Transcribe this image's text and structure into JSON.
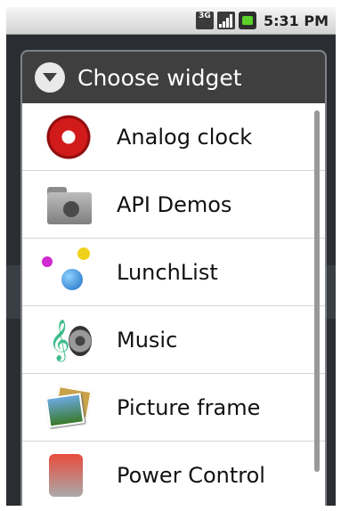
{
  "status_bar": {
    "network_label": "3G",
    "time": "5:31 PM",
    "icons": [
      "3g-icon",
      "signal-icon",
      "battery-icon"
    ]
  },
  "dialog": {
    "title": "Choose widget",
    "title_icon": "chevron-down-circle-icon",
    "items": [
      {
        "label": "Analog clock",
        "icon": "analog-clock-icon"
      },
      {
        "label": "API Demos",
        "icon": "folder-gear-icon"
      },
      {
        "label": "LunchList",
        "icon": "molecule-icon"
      },
      {
        "label": "Music",
        "icon": "music-icon"
      },
      {
        "label": "Picture frame",
        "icon": "picture-frame-icon"
      },
      {
        "label": "Power Control",
        "icon": "power-control-icon"
      }
    ]
  },
  "colors": {
    "title_bar": "#3f3f3f",
    "list_background": "#ffffff",
    "divider": "#d6d6d6",
    "battery": "#5bd12a"
  }
}
